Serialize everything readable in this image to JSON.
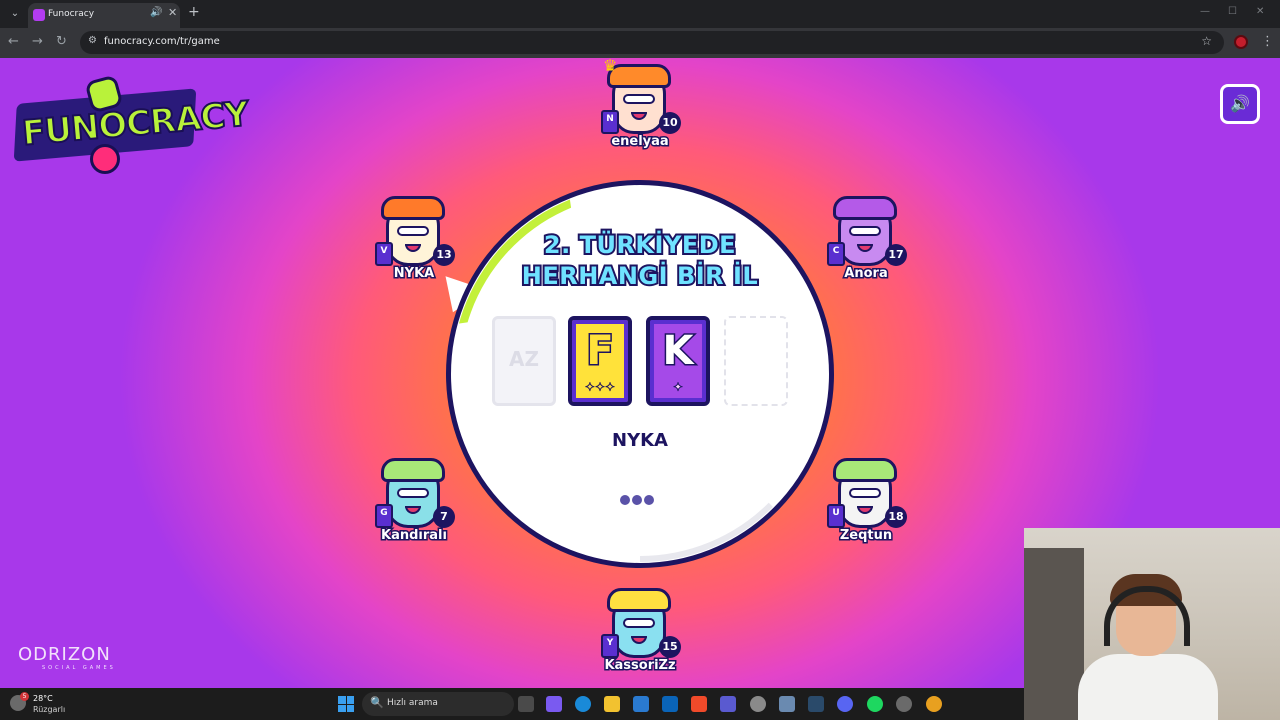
{
  "browser": {
    "tab_title": "Funocracy",
    "url": "funocracy.com/tr/game",
    "icons": {
      "menu": "chevron-down-icon",
      "audio": "speaker-icon",
      "close": "close-icon",
      "new_tab": "plus-icon",
      "back": "back-arrow-icon",
      "forward": "forward-arrow-icon",
      "reload": "reload-icon",
      "site_info": "tune-icon",
      "bookmark": "star-icon",
      "more": "kebab-icon"
    },
    "symbols": {
      "menu": "⌄",
      "audio": "🔊",
      "close": "✕",
      "new_tab": "+",
      "minimize": "—",
      "maximize": "☐",
      "window_close": "✕",
      "back": "←",
      "forward": "→",
      "reload": "↻",
      "site_info": "⚙",
      "bookmark": "☆",
      "more": "⋮"
    }
  },
  "game": {
    "logo_text": "FUNOCRACY",
    "question": "2. TÜRKİYEDE HERHANGİ BİR İL",
    "cards": [
      {
        "id": "az",
        "label": "AZ",
        "state": "used"
      },
      {
        "id": "f",
        "label": "F",
        "stars": "✦✦✦",
        "color": "#ffe23a"
      },
      {
        "id": "k",
        "label": "K",
        "stars": "✦",
        "color": "#a54ae8"
      },
      {
        "id": "empty",
        "label": "",
        "state": "empty"
      }
    ],
    "current_player": "NYKA",
    "sound_symbol": "🔊",
    "players": [
      {
        "name": "enelyaa",
        "score": "10",
        "letter": "N",
        "skin": "#ffe0d0",
        "hair": "#ff8a2a",
        "crown": "♛"
      },
      {
        "name": "NYKA",
        "score": "13",
        "letter": "V",
        "skin": "#fff4d8",
        "hair": "#ff7a2a"
      },
      {
        "name": "Anora",
        "score": "17",
        "letter": "C",
        "skin": "#c88af0",
        "hair": "#b45ae8"
      },
      {
        "name": "Kandıralı",
        "score": "7",
        "letter": "G",
        "skin": "#8ae0e8",
        "hair": "#a8e878"
      },
      {
        "name": "Zeqtun",
        "score": "18",
        "letter": "U",
        "skin": "#f4f4f4",
        "hair": "#a8e878"
      },
      {
        "name": "KassoriZz",
        "score": "15",
        "letter": "Y",
        "skin": "#8ae0f0",
        "hair": "#ffe040"
      }
    ],
    "brand": "ODRIZON",
    "brand_sub": "SOCIAL GAMES",
    "colors": {
      "accent": "#6a2bd6",
      "outline": "#1d1460",
      "timer": "#c3f03a"
    }
  },
  "taskbar": {
    "weather_temp": "28°C",
    "weather_cond": "Rüzgarlı",
    "weather_badge": "5",
    "search_placeholder": "Hızlı arama",
    "search_icon": "🔍"
  }
}
